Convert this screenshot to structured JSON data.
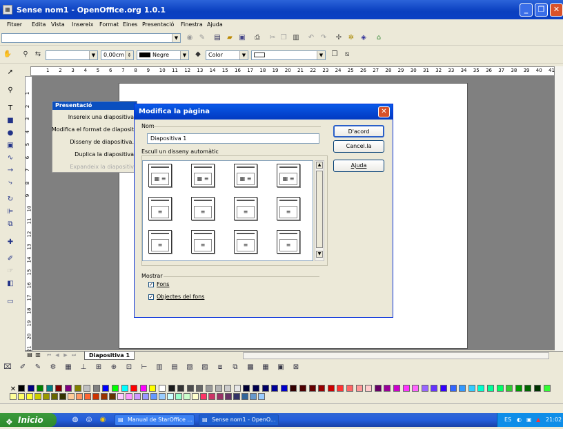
{
  "window": {
    "title": "Sense nom1 - OpenOffice.org 1.0.1"
  },
  "menu": [
    "Fitxer",
    "Edita",
    "Vista",
    "Insereix",
    "Format",
    "Eines",
    "Presentació",
    "Finestra",
    "Ajuda"
  ],
  "toolbar2": {
    "width_value": "0,00cm",
    "line_color": "Negre",
    "area_mode": "Color"
  },
  "ruler_h": [
    "1",
    "2",
    "3",
    "4",
    "5",
    "6",
    "7",
    "8",
    "9",
    "10",
    "11",
    "12",
    "13",
    "14",
    "15",
    "16",
    "17",
    "18",
    "19",
    "20",
    "21",
    "22",
    "23",
    "24",
    "25",
    "26",
    "27",
    "28",
    "29",
    "30",
    "31",
    "32",
    "33",
    "34",
    "35",
    "36",
    "37",
    "38",
    "39",
    "40",
    "41"
  ],
  "ruler_v": [
    "1",
    "2",
    "3",
    "4",
    "5",
    "6",
    "7",
    "8",
    "9",
    "10",
    "11",
    "12",
    "13",
    "14",
    "15",
    "16",
    "17",
    "18",
    "19",
    "20",
    "21"
  ],
  "presentation_panel": {
    "title": "Presentació",
    "items": [
      "Insereix una diapositiva",
      "Modifica el format de diaposit",
      "Disseny de diapositiva.",
      "Duplica la diapositiva",
      "Expandeix la diapositiv"
    ]
  },
  "slide_tab": "Diapositiva 1",
  "dialog": {
    "title": "Modifica la pàgina",
    "name_label": "Nom",
    "name_value": "Diapositiva 1",
    "layout_label": "Escull un disseny automàtic",
    "show_label": "Mostrar",
    "background_label": "Fons",
    "background_objects_label": "Objectes del fons",
    "ok_label": "D'acord",
    "cancel_label": "Cancel.la",
    "help_label": "Ajuda",
    "background_checked": true,
    "background_objects_checked": true
  },
  "taskbar": {
    "start_label": "Inicio",
    "tasks": [
      "Manual de StarOffice ...",
      "Sense nom1 - OpenO..."
    ],
    "lang": "ES",
    "clock": "21:02"
  },
  "colors": {
    "palette_row1": [
      "#000000",
      "#000080",
      "#008000",
      "#008080",
      "#800000",
      "#800080",
      "#808000",
      "#c0c0c0",
      "#808080",
      "#0000ff",
      "#00ff00",
      "#00ffff",
      "#ff0000",
      "#ff00ff",
      "#ffff00",
      "#ffffff",
      "#1a1a1a",
      "#333333",
      "#4d4d4d",
      "#666666",
      "#999999",
      "#b3b3b3",
      "#cccccc",
      "#e6e6e6",
      "#000033",
      "#00004d",
      "#000066",
      "#000099",
      "#0000cc",
      "#330000",
      "#4d0000",
      "#660000",
      "#990000",
      "#cc0000",
      "#ff3333",
      "#ff6666",
      "#ff9999",
      "#ffcccc",
      "#660066",
      "#990099",
      "#cc00cc",
      "#ff33ff",
      "#ff66ff",
      "#9966ff",
      "#6633ff",
      "#3300ff",
      "#3366ff",
      "#3399ff",
      "#33ccff",
      "#00ffcc",
      "#00ff99",
      "#00ff66",
      "#33cc33",
      "#009900",
      "#006600",
      "#003300",
      "#33ff33"
    ],
    "palette_row2": [
      "#ffff99",
      "#ffff66",
      "#ffff33",
      "#cccc00",
      "#999900",
      "#666600",
      "#333300",
      "#ffcc99",
      "#ff9966",
      "#ff6633",
      "#cc3300",
      "#993300",
      "#663300",
      "#ffccff",
      "#ff99ff",
      "#cc99ff",
      "#9999ff",
      "#6699ff",
      "#99ccff",
      "#ccffff",
      "#99ffcc",
      "#ccffcc",
      "#ffffcc",
      "#ff3366",
      "#cc3366",
      "#993366",
      "#663366",
      "#333366",
      "#336699",
      "#6699cc",
      "#99ccff"
    ]
  }
}
